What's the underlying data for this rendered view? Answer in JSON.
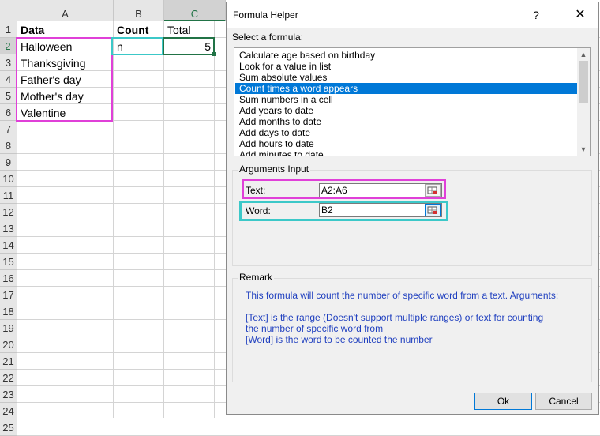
{
  "sheet": {
    "columns": [
      "A",
      "B",
      "C"
    ],
    "rows": [
      "1",
      "2",
      "3",
      "4",
      "5",
      "6",
      "7",
      "8",
      "9",
      "10",
      "11",
      "12",
      "13",
      "14",
      "15",
      "16",
      "17",
      "18",
      "19",
      "20",
      "21",
      "22",
      "23",
      "24",
      "25"
    ],
    "header_row": {
      "a": "Data",
      "b": "Count",
      "c": "Total"
    },
    "data_col": [
      "Halloween",
      "Thanksgiving",
      "Father's day",
      "Mother's day",
      "Valentine"
    ],
    "b2": "n",
    "c2": "5"
  },
  "colors": {
    "accent_blue": "#0078d7",
    "highlight_magenta": "#e040d8",
    "highlight_cyan": "#3cc8c8",
    "remark_text": "#1f3fbf"
  },
  "dialog": {
    "title": "Formula Helper",
    "help": "?",
    "close": "✕",
    "select_label": "Select a formula:",
    "formulas": [
      "Calculate age based on birthday",
      "Look for a value in list",
      "Sum absolute values",
      "Count times a word appears",
      "Sum numbers in a cell",
      "Add years to date",
      "Add months to date",
      "Add days to date",
      "Add hours to date",
      "Add minutes to date"
    ],
    "selected_formula": "Count times a word appears",
    "arguments_label": "Arguments Input",
    "text_label": "Text:",
    "text_value": "A2:A6",
    "word_label": "Word:",
    "word_value": "B2",
    "remark_label": "Remark",
    "remark_lines": [
      "This formula will count the number of specific word from a text. Arguments:",
      "[Text] is the range (Doesn't support multiple ranges) or text for counting",
      "the number of specific word from",
      "[Word] is the word to be counted the number"
    ],
    "ok_label": "Ok",
    "cancel_label": "Cancel"
  },
  "icons": {
    "range_select": "range-select-icon",
    "scroll_up": "scroll-up-arrow-icon",
    "scroll_down": "scroll-down-arrow-icon"
  }
}
